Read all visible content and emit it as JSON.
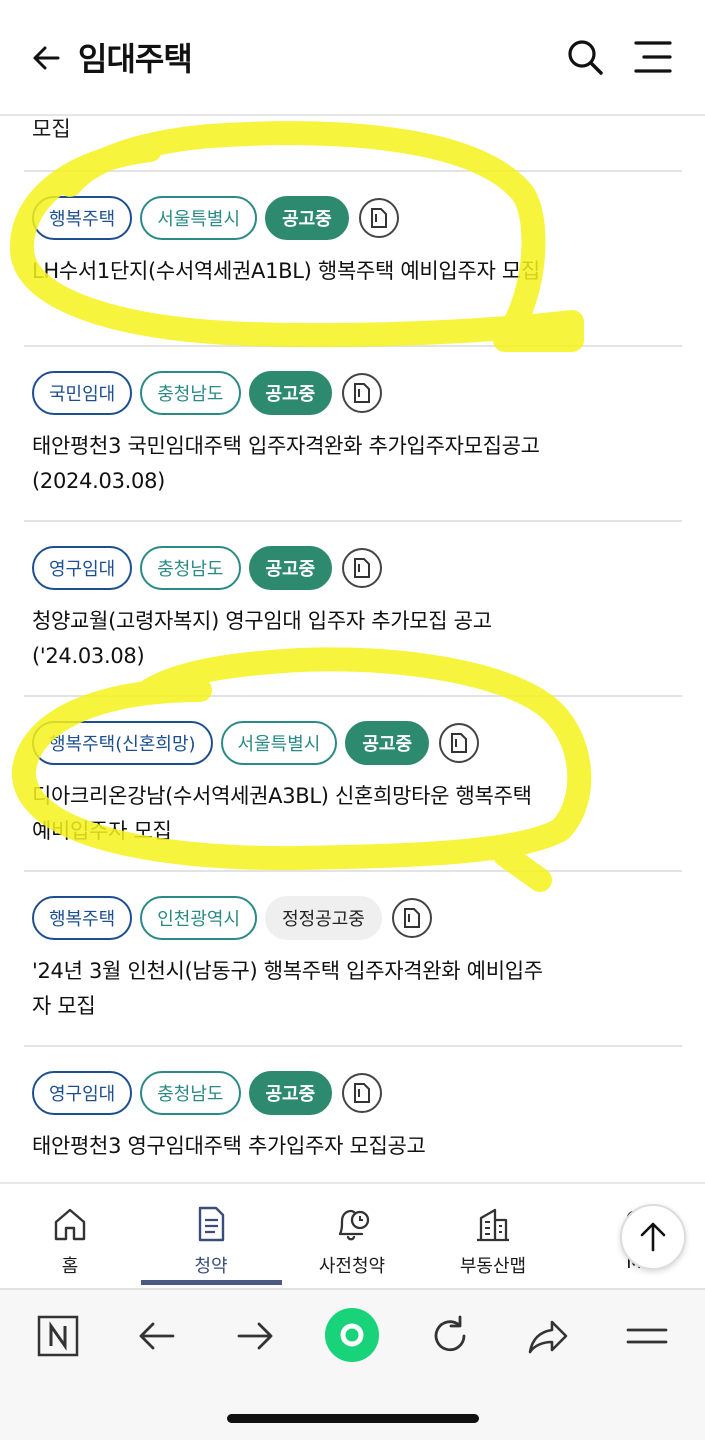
{
  "header": {
    "title": "임대주택"
  },
  "list": {
    "partial_title": "모집",
    "items": [
      {
        "type": "행복주택",
        "region": "서울특별시",
        "status": "공고중",
        "status_style": "green",
        "title": "LH수서1단지(수서역세권A1BL) 행복주택 예비입주자 모집"
      },
      {
        "type": "국민임대",
        "region": "충청남도",
        "status": "공고중",
        "status_style": "green",
        "title": "태안평천3 국민임대주택 입주자격완화 추가입주자모집공고(2024.03.08)"
      },
      {
        "type": "영구임대",
        "region": "충청남도",
        "status": "공고중",
        "status_style": "green",
        "title": "청양교월(고령자복지) 영구임대 입주자 추가모집 공고('24.03.08)"
      },
      {
        "type": "행복주택(신혼희망)",
        "region": "서울특별시",
        "status": "공고중",
        "status_style": "green",
        "title": "디아크리온강남(수서역세권A3BL) 신혼희망타운 행복주택 예비입주자 모집"
      },
      {
        "type": "행복주택",
        "region": "인천광역시",
        "status": "정정공고중",
        "status_style": "gray",
        "title": "'24년 3월 인천시(남동구) 행복주택 입주자격완화 예비입주자 모집"
      },
      {
        "type": "영구임대",
        "region": "충청남도",
        "status": "공고중",
        "status_style": "green",
        "title": "태안평천3 영구임대주택 추가입주자 모집공고"
      }
    ]
  },
  "bottom_nav": {
    "items": [
      {
        "label": "홈",
        "icon": "home-icon"
      },
      {
        "label": "청약",
        "icon": "document-icon"
      },
      {
        "label": "사전청약",
        "icon": "bell-clock-icon"
      },
      {
        "label": "부동산맵",
        "icon": "building-icon"
      },
      {
        "label": "M",
        "icon": "more-icon"
      }
    ],
    "active_index": 1
  },
  "colors": {
    "type_tag": "#1d4f8f",
    "region_tag": "#2b8a85",
    "status_green": "#2d8a6e",
    "highlight": "#f5f21a"
  }
}
